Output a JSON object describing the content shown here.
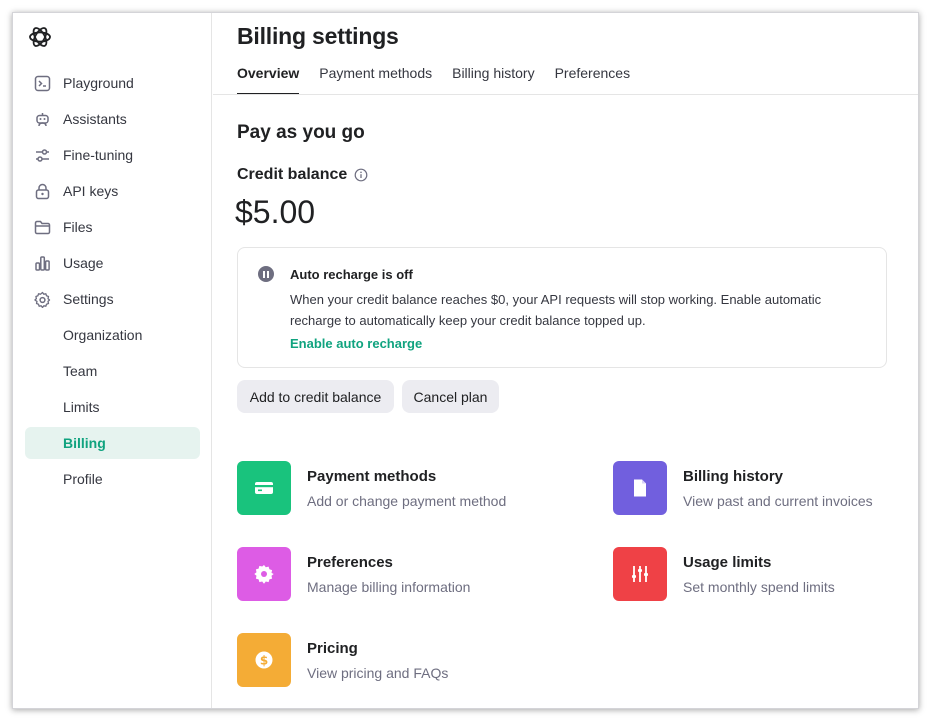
{
  "sidebar": {
    "logo_icon": "openai-logo-icon",
    "items": [
      {
        "label": "Playground",
        "icon": "terminal-icon"
      },
      {
        "label": "Assistants",
        "icon": "robot-icon"
      },
      {
        "label": "Fine-tuning",
        "icon": "sliders-icon"
      },
      {
        "label": "API keys",
        "icon": "lock-icon"
      },
      {
        "label": "Files",
        "icon": "folder-icon"
      },
      {
        "label": "Usage",
        "icon": "bar-chart-icon"
      },
      {
        "label": "Settings",
        "icon": "gear-icon"
      }
    ],
    "sub_items": [
      {
        "label": "Organization"
      },
      {
        "label": "Team"
      },
      {
        "label": "Limits"
      },
      {
        "label": "Billing",
        "active": true
      },
      {
        "label": "Profile"
      }
    ]
  },
  "header": {
    "title": "Billing settings",
    "tabs": [
      {
        "label": "Overview",
        "active": true
      },
      {
        "label": "Payment methods"
      },
      {
        "label": "Billing history"
      },
      {
        "label": "Preferences"
      }
    ]
  },
  "overview": {
    "section_title": "Pay as you go",
    "credit_label": "Credit balance",
    "credit_info_icon": "info-icon",
    "credit_amount": "$5.00",
    "notice": {
      "icon": "pause-icon",
      "title": "Auto recharge is off",
      "body": "When your credit balance reaches $0, your API requests will stop working. Enable automatic recharge to automatically keep your credit balance topped up.",
      "link": "Enable auto recharge"
    },
    "buttons": {
      "add_credit": "Add to credit balance",
      "cancel_plan": "Cancel plan"
    }
  },
  "cards": [
    {
      "title": "Payment methods",
      "description": "Add or change payment method",
      "icon": "credit-card-icon",
      "color": "#19c37d"
    },
    {
      "title": "Billing history",
      "description": "View past and current invoices",
      "icon": "document-icon",
      "color": "#715fde"
    },
    {
      "title": "Preferences",
      "description": "Manage billing information",
      "icon": "gear-icon",
      "color": "#dd5ce5"
    },
    {
      "title": "Usage limits",
      "description": "Set monthly spend limits",
      "icon": "sliders-icon",
      "color": "#ef4146"
    },
    {
      "title": "Pricing",
      "description": "View pricing and FAQs",
      "icon": "dollar-icon",
      "color": "#f4ac36"
    }
  ],
  "colors": {
    "accent": "#10a37f",
    "active_bg": "#e6f3ef",
    "button_bg": "#ececf1"
  }
}
